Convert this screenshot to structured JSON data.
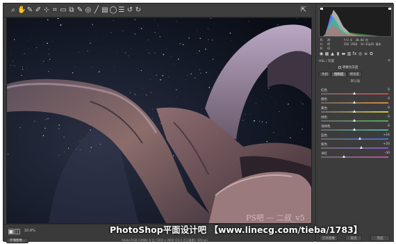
{
  "toolbar": {
    "tools": [
      {
        "icon": "zoom-icon",
        "glyph": "⌕"
      },
      {
        "icon": "hand-icon",
        "glyph": "✋"
      },
      {
        "icon": "white-balance-icon",
        "glyph": "✎"
      },
      {
        "icon": "color-sampler-icon",
        "glyph": "✐"
      },
      {
        "icon": "target-adjust-icon",
        "glyph": "⊹"
      },
      {
        "icon": "crop-icon",
        "glyph": "⌗"
      },
      {
        "icon": "straighten-icon",
        "glyph": "▭"
      },
      {
        "icon": "transform-icon",
        "glyph": "⧉"
      },
      {
        "icon": "spot-removal-icon",
        "glyph": "✎"
      },
      {
        "icon": "red-eye-icon",
        "glyph": "◎"
      },
      {
        "icon": "adjustment-brush-icon",
        "glyph": "╱"
      },
      {
        "icon": "graduated-filter-icon",
        "glyph": "▤"
      },
      {
        "icon": "radial-filter-icon",
        "glyph": "◯"
      },
      {
        "icon": "preferences-icon",
        "glyph": "☰"
      },
      {
        "icon": "rotate-left-icon",
        "glyph": "↺"
      },
      {
        "icon": "rotate-right-icon",
        "glyph": "↻"
      }
    ],
    "fullscreen_icon": "⇱"
  },
  "histogram": {
    "rgb_line_1": "R:  39        f/2.8  30.00 秒",
    "rgb_line_2": "G:  45        ISO 2500  16-35@16 毫米",
    "rgb_line_3": "B:  42"
  },
  "panel": {
    "title_left": "HSL / 灰度",
    "title_right": "≡",
    "convert_label": "转换为灰度",
    "tabs": [
      "色相",
      "饱和度",
      "明亮度"
    ],
    "active_tab": 1,
    "defaults_label": "默认值",
    "sliders": [
      {
        "label": "红色",
        "value": "0",
        "fraction": 0.5,
        "color": "#c94a4a"
      },
      {
        "label": "橙色",
        "value": "0",
        "fraction": 0.5,
        "color": "#d28b3f"
      },
      {
        "label": "黄色",
        "value": "0",
        "fraction": 0.5,
        "color": "#cfc54a"
      },
      {
        "label": "绿色",
        "value": "0",
        "fraction": 0.5,
        "color": "#4fae56"
      },
      {
        "label": "浅绿色",
        "value": "0",
        "fraction": 0.5,
        "color": "#45b2a5"
      },
      {
        "label": "蓝色",
        "value": "+16",
        "fraction": 0.58,
        "color": "#4a6fd1"
      },
      {
        "label": "紫色",
        "value": "+20",
        "fraction": 0.6,
        "color": "#8b52c9"
      },
      {
        "label": "洋红",
        "value": "-30",
        "fraction": 0.35,
        "color": "#c84ba6"
      }
    ]
  },
  "bottom": {
    "zoom": "10.6%",
    "save_label": "存储图像...",
    "info": "Adobe RGB (1998); 8 位; 5000 x 3000 (15.0 百万像素); 300 ppi",
    "open_label": "打开图像",
    "cancel_label": "取消",
    "done_label": "完成"
  },
  "watermark": "PhotoShop平面设计吧 【www.linecg.com/tieba/1783】",
  "photo_credit": "PS吧 — 二叔_v5"
}
